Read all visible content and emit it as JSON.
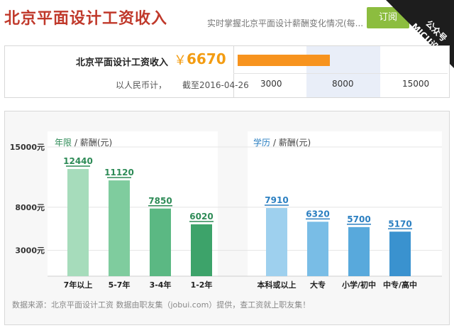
{
  "header": {
    "title": "北京平面设计工资收入",
    "subtitle": "实时掌握北京平面设计薪酬变化情况(每...",
    "subscribe_label": "订阅",
    "corner_badge": "公众号\nMICU设计"
  },
  "salary": {
    "label": "北京平面设计工资收入",
    "currency": "￥",
    "value": "6670",
    "unit_text": "以人民币计，",
    "date_text": "截至2016-04-26",
    "range_ticks": [
      "3000",
      "8000",
      "15000"
    ],
    "bar_value": 6670,
    "bar_max": 15000
  },
  "chart_data": [
    {
      "type": "bar",
      "title_highlight": "年限",
      "title_rest": " / 薪酬(元)",
      "categories": [
        "7年以上",
        "5-7年",
        "3-4年",
        "1-2年"
      ],
      "values": [
        12440,
        11120,
        7850,
        6020
      ],
      "ylim": [
        0,
        15000
      ],
      "yticks": [
        3000,
        8000,
        15000
      ],
      "ytick_labels": [
        "3000元",
        "8000元",
        "15000元"
      ],
      "bar_colors": [
        "#a6dcbb",
        "#7fcc9e",
        "#5bb883",
        "#3da36a"
      ]
    },
    {
      "type": "bar",
      "title_highlight": "学历",
      "title_rest": " / 薪酬(元)",
      "categories": [
        "本科或以上",
        "大专",
        "小学/初中",
        "中专/高中"
      ],
      "values": [
        7910,
        6320,
        5700,
        5170
      ],
      "ylim": [
        0,
        15000
      ],
      "bar_colors": [
        "#9ed0ee",
        "#79bde6",
        "#58a9dc",
        "#3a92cf"
      ]
    }
  ],
  "footer": {
    "source": "数据来源：北京平面设计工资 数据由职友集（jobui.com）提供，查工资就上职友集！"
  },
  "colors": {
    "title_red": "#c0392b",
    "accent_orange": "#f7931e",
    "green_label": "#2e8b57",
    "blue_label": "#2b7fc1"
  }
}
